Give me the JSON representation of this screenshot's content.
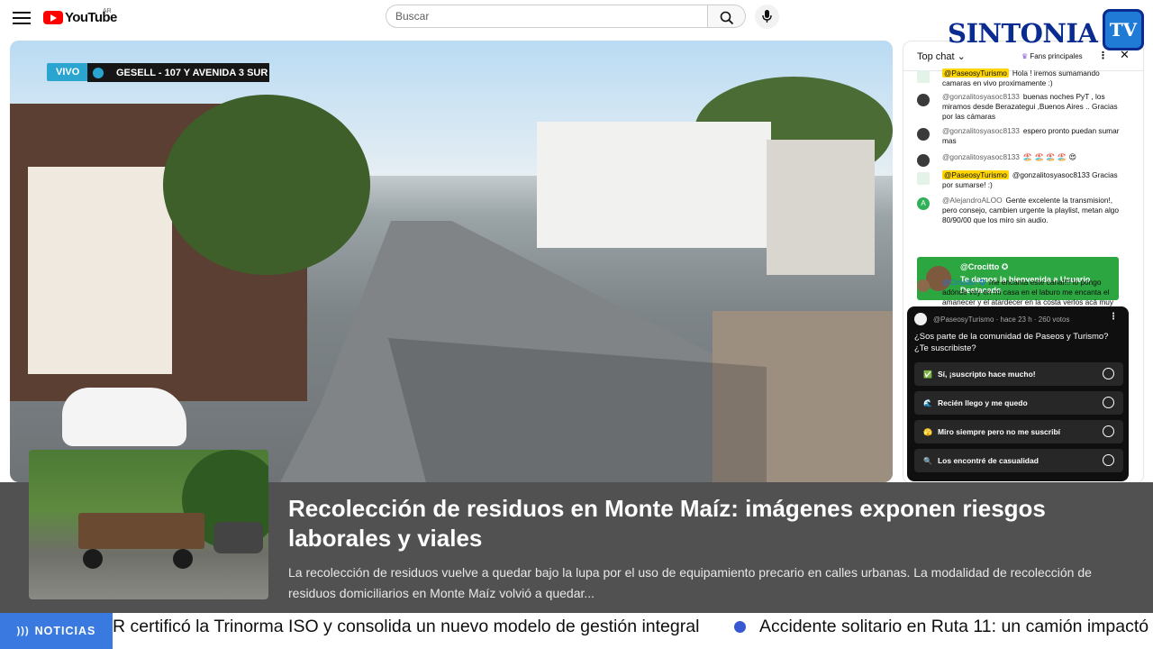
{
  "youtube": {
    "logo_text": "YouTube",
    "country": "AR",
    "search_placeholder": "Buscar"
  },
  "video": {
    "live_label": "VIVO",
    "camera_label": "GESELL  - 107 Y AVENIDA 3 SUR"
  },
  "brand": {
    "name": "SINTONIA",
    "tv": "TV"
  },
  "chat": {
    "mode": "Top chat",
    "fans_label": "Fans principales",
    "messages": [
      {
        "author": "@PaseosyTurismo",
        "owner": true,
        "text": "Hola ! iremos sumamando camaras en vivo proximamente :)"
      },
      {
        "author": "@gonzalitosyasoc8133",
        "owner": false,
        "text": "buenas noches PyT , los miramos desde Berazategui ,Buenos Aires .. Gracias por las cámaras"
      },
      {
        "author": "@gonzalitosyasoc8133",
        "owner": false,
        "text": "espero pronto puedan sumar mas"
      },
      {
        "author": "@gonzalitosyasoc8133",
        "owner": false,
        "text": "🏖️ 🏖️ 🏖️ 🏖️ 😍"
      },
      {
        "author": "@PaseosyTurismo",
        "owner": true,
        "text": "@gonzalitosyasoc8133 Gracias por sumarse! :)"
      },
      {
        "author": "@AlejandroALOO",
        "owner": false,
        "avatar_letter": "A",
        "text": "Gente excelente la transmision!, pero consejo, cambien urgente la playlist, metan algo 80/90/00 que los miro sin audio."
      },
      {
        "author": "@Crocitto",
        "owner": false,
        "text": "me encanta este canal!!! lo pongo adónde voy en mi casa en el laburo me encanta el amanecer y el atardecer en la costa verlos acá muy"
      }
    ],
    "welcome": {
      "name": "@Crocitto",
      "text": "Te damos la bienvenida a Usuario Destacado"
    },
    "poll": {
      "meta": "@PaseosyTurismo · hace 23 h · 260 votos",
      "question": "¿Sos parte de la comunidad de Paseos y Turismo? ¿Te suscribiste?",
      "options": [
        {
          "icon": "✅",
          "label": "Sí, ¡suscripto hace mucho!"
        },
        {
          "icon": "🌊",
          "label": "Recién llego y me quedo"
        },
        {
          "icon": "🫣",
          "label": "Miro siempre pero no me suscribí"
        },
        {
          "icon": "🔍",
          "label": "Los encontré de casualidad"
        }
      ]
    }
  },
  "news": {
    "title": "Recolección de residuos en Monte Maíz: imágenes exponen riesgos laborales y viales",
    "description": "La recolección de residuos vuelve a quedar bajo la lupa por el uso de equipamiento precario en calles urbanas. La modalidad de recolección de residuos domiciliarios en Monte Maíz volvió a quedar..."
  },
  "ticker": {
    "label": "NOTICIAS",
    "items": [
      "R certificó la Trinorma ISO y consolida un nuevo modelo de gestión integral",
      "Accidente solitario en Ruta 11: un camión impactó"
    ]
  }
}
